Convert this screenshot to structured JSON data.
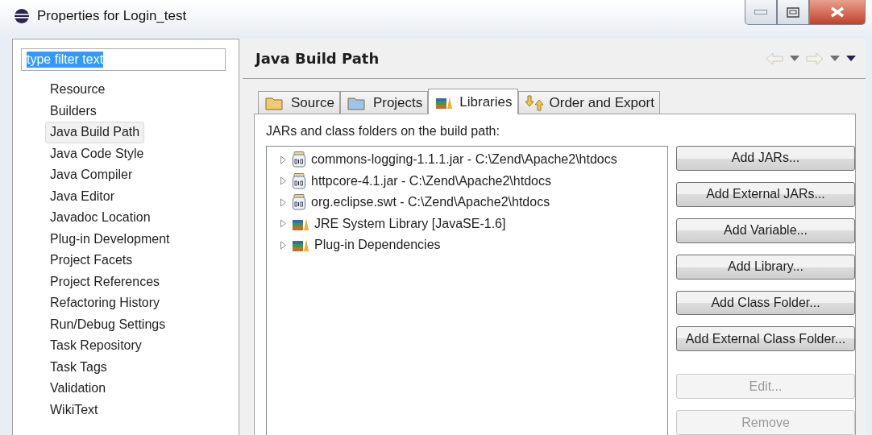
{
  "window": {
    "title": "Properties for Login_test"
  },
  "filter": {
    "value": "type filter text",
    "highlighted": true
  },
  "sidebar": {
    "items": [
      {
        "label": "Resource",
        "selected": false
      },
      {
        "label": "Builders",
        "selected": false
      },
      {
        "label": "Java Build Path",
        "selected": true
      },
      {
        "label": "Java Code Style",
        "selected": false
      },
      {
        "label": "Java Compiler",
        "selected": false
      },
      {
        "label": "Java Editor",
        "selected": false
      },
      {
        "label": "Javadoc Location",
        "selected": false
      },
      {
        "label": "Plug-in Development",
        "selected": false
      },
      {
        "label": "Project Facets",
        "selected": false
      },
      {
        "label": "Project References",
        "selected": false
      },
      {
        "label": "Refactoring History",
        "selected": false
      },
      {
        "label": "Run/Debug Settings",
        "selected": false
      },
      {
        "label": "Task Repository",
        "selected": false
      },
      {
        "label": "Task Tags",
        "selected": false
      },
      {
        "label": "Validation",
        "selected": false
      },
      {
        "label": "WikiText",
        "selected": false
      }
    ]
  },
  "page": {
    "title": "Java Build Path"
  },
  "tabs": [
    {
      "label": "Source",
      "kind": "source",
      "selected": false
    },
    {
      "label": "Projects",
      "kind": "projects",
      "selected": false
    },
    {
      "label": "Libraries",
      "kind": "libraries",
      "selected": true
    },
    {
      "label": "Order and Export",
      "kind": "order",
      "selected": false
    }
  ],
  "libraries": {
    "caption": "JARs and class folders on the build path:",
    "items": [
      {
        "label": "commons-logging-1.1.1.jar - C:\\Zend\\Apache2\\htdocs",
        "kind": "jar",
        "expanded": false
      },
      {
        "label": "httpcore-4.1.jar - C:\\Zend\\Apache2\\htdocs",
        "kind": "jar",
        "expanded": false
      },
      {
        "label": "org.eclipse.swt - C:\\Zend\\Apache2\\htdocs",
        "kind": "jar",
        "expanded": false
      },
      {
        "label": "JRE System Library [JavaSE-1.6]",
        "kind": "library",
        "expanded": false
      },
      {
        "label": "Plug-in Dependencies",
        "kind": "library",
        "expanded": false
      }
    ],
    "buttons": [
      {
        "label": "Add JARs...",
        "disabled": false
      },
      {
        "label": "Add External JARs...",
        "disabled": false
      },
      {
        "label": "Add Variable...",
        "disabled": false
      },
      {
        "label": "Add Library...",
        "disabled": false
      },
      {
        "label": "Add Class Folder...",
        "disabled": false
      },
      {
        "label": "Add External Class Folder...",
        "disabled": false
      },
      {
        "label": "Edit...",
        "disabled": true
      },
      {
        "label": "Remove",
        "disabled": true
      }
    ]
  }
}
